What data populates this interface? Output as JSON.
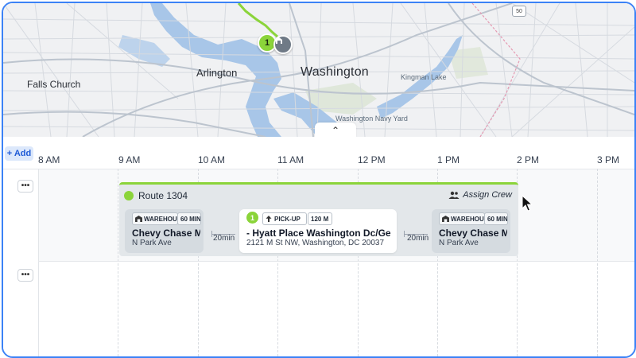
{
  "map": {
    "labels": {
      "falls_church": "Falls Church",
      "arlington": "Arlington",
      "washington": "Washington",
      "kingman_lake": "Kingman Lake",
      "navy_yard": "Washington Navy Yard"
    },
    "road_shield": "50",
    "stop_marker": "1",
    "collapse_glyph": "⌃"
  },
  "timeline": {
    "add_label": "+ Add",
    "hours": [
      "8 AM",
      "9 AM",
      "10 AM",
      "11 AM",
      "12 PM",
      "1 PM",
      "2 PM",
      "3 PM"
    ],
    "more_glyph": "•••"
  },
  "route": {
    "name": "Route 1304",
    "color": "#8bd43a",
    "assign_crew": "Assign Crew",
    "stops": [
      {
        "type": "WAREHOUSE",
        "duration": "60 MIN",
        "title": "Chevy Chase M",
        "subtitle": "N Park Ave",
        "icon": "warehouse-icon"
      },
      {
        "number": "1",
        "type": "PICK-UP",
        "duration": "120 M",
        "title": "- Hyatt Place Washington Dc/Georgetown",
        "subtitle": "2121 M St NW, Washington, DC 20037",
        "icon": "arrow-up-icon"
      },
      {
        "type": "WAREHOUSE",
        "duration": "60 MIN",
        "title": "Chevy Chase M",
        "subtitle": "N Park Ave",
        "icon": "warehouse-icon"
      }
    ],
    "travel": [
      "20min",
      "20min"
    ]
  }
}
